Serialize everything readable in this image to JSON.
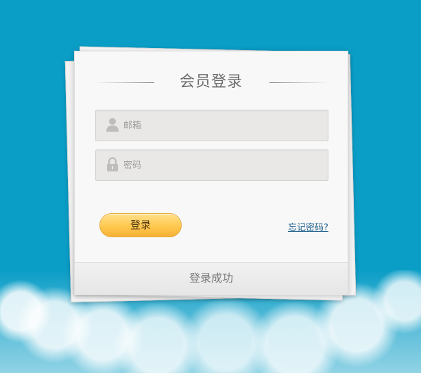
{
  "login_card": {
    "title": "会员登录",
    "email_field": {
      "value": "",
      "placeholder": "邮箱",
      "icon": "user-icon"
    },
    "password_field": {
      "value": "",
      "placeholder": "密码",
      "icon": "lock-icon"
    },
    "login_button_label": "登录",
    "forgot_password_label": "忘记密码?",
    "status_message": "登录成功"
  },
  "colors": {
    "background": "#0a9dc6",
    "card": "#f8f8f8",
    "input": "#e9e8e6",
    "button_top": "#ffe08a",
    "button_bottom": "#f5b136",
    "link": "#1d5f8a"
  }
}
